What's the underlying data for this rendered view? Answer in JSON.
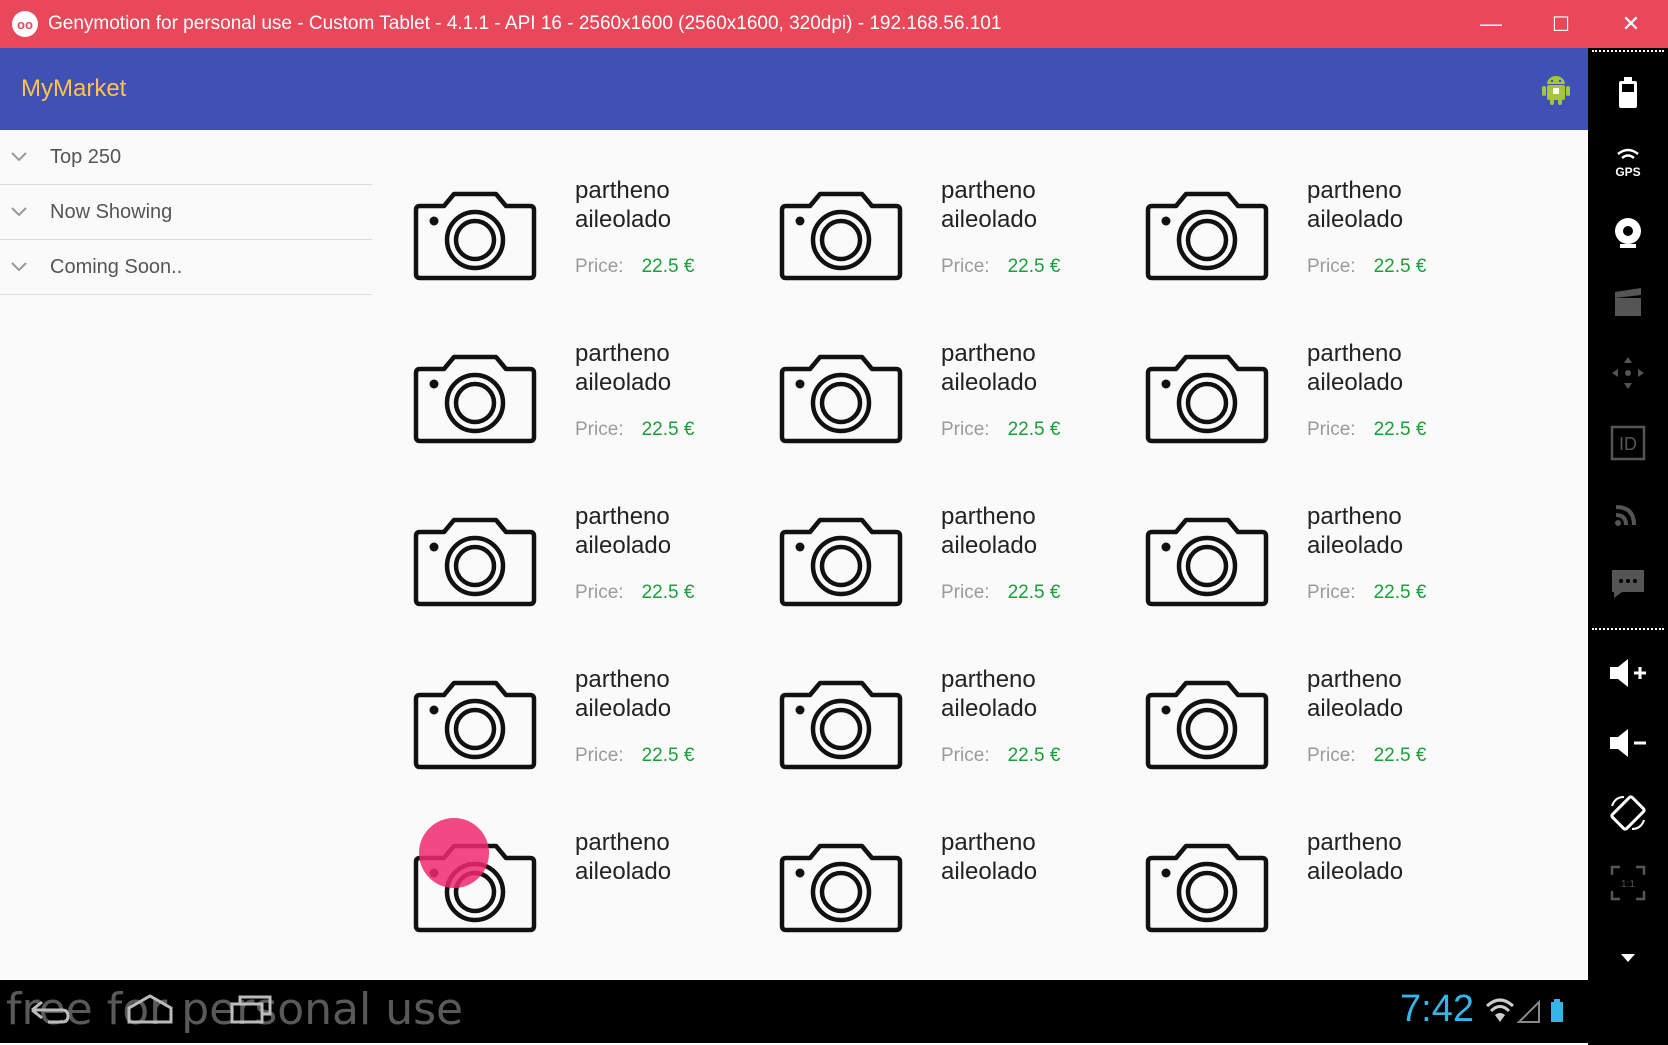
{
  "window": {
    "title": "Genymotion for personal use - Custom Tablet - 4.1.1 - API 16 - 2560x1600 (2560x1600, 320dpi) - 192.168.56.101",
    "minimize_glyph": "—",
    "maximize_glyph": "☐",
    "close_glyph": "✕",
    "icon": "genymotion-logo-icon"
  },
  "app": {
    "title": "MyMarket",
    "header_icon": "android-icon"
  },
  "sidebar": {
    "items": [
      {
        "label": "Top 250"
      },
      {
        "label": "Now Showing"
      },
      {
        "label": "Coming Soon.."
      }
    ]
  },
  "products": {
    "price_label": "Price:",
    "items": [
      {
        "name_line1": "partheno",
        "name_line2": "aileolado",
        "price": "22.5 €"
      },
      {
        "name_line1": "partheno",
        "name_line2": "aileolado",
        "price": "22.5 €"
      },
      {
        "name_line1": "partheno",
        "name_line2": "aileolado",
        "price": "22.5 €"
      },
      {
        "name_line1": "partheno",
        "name_line2": "aileolado",
        "price": "22.5 €"
      },
      {
        "name_line1": "partheno",
        "name_line2": "aileolado",
        "price": "22.5 €"
      },
      {
        "name_line1": "partheno",
        "name_line2": "aileolado",
        "price": "22.5 €"
      },
      {
        "name_line1": "partheno",
        "name_line2": "aileolado",
        "price": "22.5 €"
      },
      {
        "name_line1": "partheno",
        "name_line2": "aileolado",
        "price": "22.5 €"
      },
      {
        "name_line1": "partheno",
        "name_line2": "aileolado",
        "price": "22.5 €"
      },
      {
        "name_line1": "partheno",
        "name_line2": "aileolado",
        "price": "22.5 €"
      },
      {
        "name_line1": "partheno",
        "name_line2": "aileolado",
        "price": "22.5 €"
      },
      {
        "name_line1": "partheno",
        "name_line2": "aileolado",
        "price": "22.5 €"
      },
      {
        "name_line1": "partheno",
        "name_line2": "aileolado",
        "price": ""
      },
      {
        "name_line1": "partheno",
        "name_line2": "aileolado",
        "price": ""
      },
      {
        "name_line1": "partheno",
        "name_line2": "aileolado",
        "price": ""
      }
    ]
  },
  "navbar": {
    "watermark": "free for personal use",
    "clock": "7:42"
  },
  "toolbar": {
    "tools": [
      "battery-icon",
      "gps-icon",
      "webcam-icon",
      "capture-icon",
      "dpad-icon",
      "id-icon",
      "rss-icon",
      "sms-icon",
      "volume-up-icon",
      "volume-down-icon",
      "rotate-icon",
      "scale-icon"
    ],
    "gps_label": "GPS",
    "id_label": "ID"
  },
  "colors": {
    "titlebar": "#e8485a",
    "appbar": "#3f51b5",
    "app_title": "#ffc24a",
    "price": "#1a9f3a",
    "clock": "#33b5e5"
  }
}
